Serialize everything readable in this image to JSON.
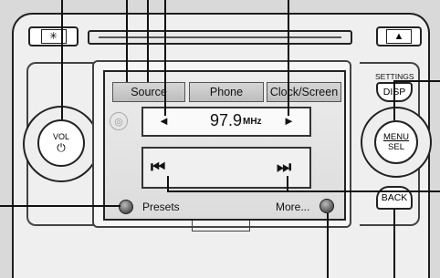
{
  "top_buttons": {
    "brightness_icon": "✳",
    "eject_icon": "▲"
  },
  "tabs": [
    {
      "label": "Source"
    },
    {
      "label": "Phone"
    },
    {
      "label": "Clock/Screen"
    }
  ],
  "tuner": {
    "prev_arrow": "◄",
    "frequency": "97.9",
    "unit": "MHz",
    "next_arrow": "►"
  },
  "track": {
    "skip_back": "⏮",
    "skip_forward": "⏭"
  },
  "bottom": {
    "presets_label": "Presets",
    "more_label": "More..."
  },
  "volume_knob": {
    "label": "VOL",
    "power_symbol": "⏻"
  },
  "right_panel": {
    "settings_label": "SETTINGS",
    "disp_label": "DISP",
    "menu_label": "MENU",
    "sel_label": "SEL",
    "back_label": "BACK"
  }
}
